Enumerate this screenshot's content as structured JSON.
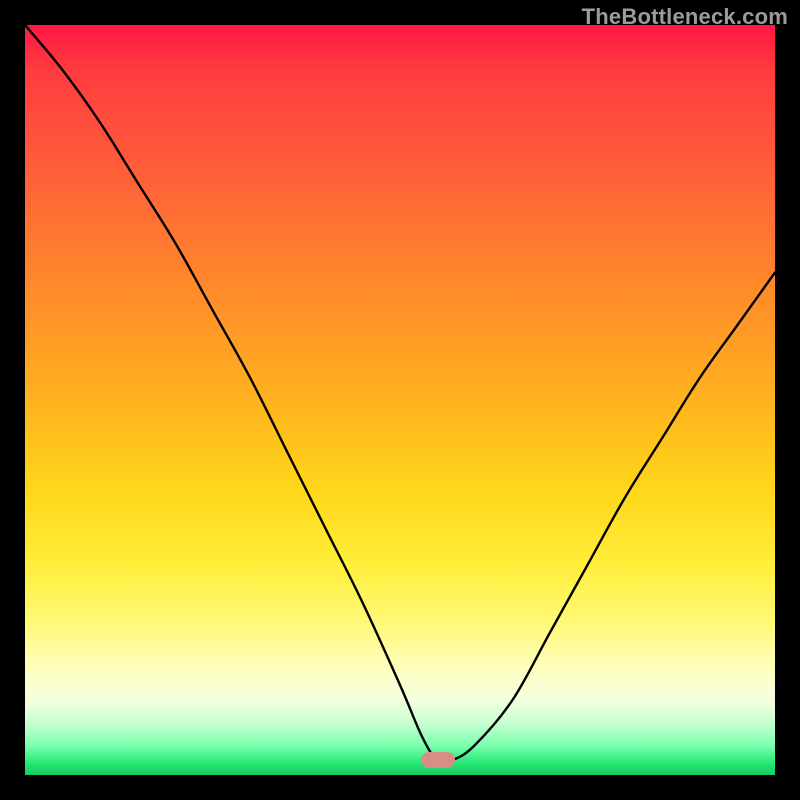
{
  "watermark": "TheBottleneck.com",
  "marker": {
    "x_pct": 55,
    "y_pct": 98
  },
  "chart_data": {
    "type": "line",
    "title": "",
    "xlabel": "",
    "ylabel": "",
    "xlim": [
      0,
      100
    ],
    "ylim": [
      0,
      100
    ],
    "grid": false,
    "legend": false,
    "series": [
      {
        "name": "bottleneck-curve",
        "x": [
          0,
          5,
          10,
          15,
          20,
          25,
          30,
          35,
          40,
          45,
          50,
          53,
          55,
          57,
          60,
          65,
          70,
          75,
          80,
          85,
          90,
          95,
          100
        ],
        "y": [
          100,
          94,
          87,
          79,
          71,
          62,
          53,
          43,
          33,
          23,
          12,
          5,
          2,
          2,
          4,
          10,
          19,
          28,
          37,
          45,
          53,
          60,
          67
        ]
      }
    ],
    "annotations": [
      {
        "type": "marker",
        "label": "optimal-point",
        "x": 55,
        "y": 2
      }
    ]
  }
}
